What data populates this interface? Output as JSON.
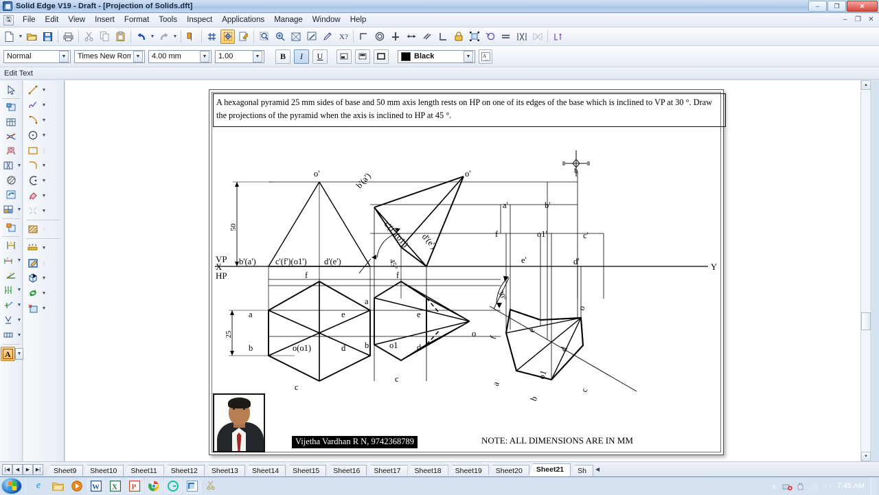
{
  "window": {
    "title": "Solid Edge V19 - Draft - [Projection of Solids.dft]",
    "app_icon": "solid-edge-icon",
    "minimize": "–",
    "maximize": "❐",
    "close": "✕",
    "mdi_minimize": "–",
    "mdi_restore": "❐",
    "mdi_close": "✕"
  },
  "menu": {
    "items": [
      "File",
      "Edit",
      "View",
      "Insert",
      "Format",
      "Tools",
      "Inspect",
      "Applications",
      "Manage",
      "Window",
      "Help"
    ]
  },
  "toolbar_main": {
    "items": [
      {
        "name": "new-document-icon",
        "glyph": "🗋"
      },
      {
        "name": "new-document-dropdown-icon",
        "glyph": "▾"
      },
      {
        "name": "open-icon",
        "glyph": "📂"
      },
      {
        "name": "save-icon",
        "glyph": "💾"
      },
      {
        "name": "print-icon",
        "glyph": "🖶"
      },
      {
        "name": "cut-icon",
        "glyph": "✂"
      },
      {
        "name": "copy-icon",
        "glyph": "⧉"
      },
      {
        "name": "paste-icon",
        "glyph": "📋"
      },
      {
        "name": "undo-icon",
        "glyph": "↰"
      },
      {
        "name": "undo-dropdown-icon",
        "glyph": "▾"
      },
      {
        "name": "redo-icon",
        "glyph": "↱"
      },
      {
        "name": "redo-dropdown-icon",
        "glyph": "▾"
      },
      {
        "name": "page-setup-icon",
        "glyph": "🏳"
      },
      {
        "name": "grid-icon",
        "glyph": "#"
      },
      {
        "name": "select-tool-icon",
        "glyph": "✛"
      },
      {
        "name": "edit-definition-icon",
        "glyph": "🗒"
      },
      {
        "name": "zoom-area-icon",
        "glyph": "🔍"
      },
      {
        "name": "zoom-in-icon",
        "glyph": "🔎"
      },
      {
        "name": "fit-icon",
        "glyph": "⛶"
      },
      {
        "name": "pan-icon",
        "glyph": "✋"
      },
      {
        "name": "sketch-view-icon",
        "glyph": "◈"
      },
      {
        "name": "help-pointer-icon",
        "glyph": "?"
      }
    ],
    "relation_items": [
      {
        "name": "connect-relation-icon",
        "glyph": "⌐"
      },
      {
        "name": "concentric-relation-icon",
        "glyph": "◎"
      },
      {
        "name": "horizontal-vertical-relation-icon",
        "glyph": "✛"
      },
      {
        "name": "equal-length-relation-icon",
        "glyph": "↔"
      },
      {
        "name": "parallel-relation-icon",
        "glyph": "⫽"
      },
      {
        "name": "perpendicular-relation-icon",
        "glyph": "∟"
      },
      {
        "name": "lock-relation-icon",
        "glyph": "🔒"
      },
      {
        "name": "rigid-set-relation-icon",
        "glyph": "▣"
      },
      {
        "name": "tangent-relation-icon",
        "glyph": "◯"
      },
      {
        "name": "equal-relation-icon",
        "glyph": "="
      },
      {
        "name": "symmetric-relation-icon",
        "glyph": "⧛"
      },
      {
        "name": "symmetry-axis-icon",
        "glyph": "⧜"
      },
      {
        "name": "relationship-handles-icon",
        "glyph": "⊥"
      }
    ]
  },
  "format_toolbar": {
    "style": {
      "value": "Normal",
      "placeholder": "Normal"
    },
    "font": {
      "value": "Times New Roman",
      "placeholder": "Times New Roman"
    },
    "size": {
      "value": "4.00 mm",
      "placeholder": "4.00 mm"
    },
    "scale": {
      "value": "1.00",
      "placeholder": "1.00"
    },
    "bold_label": "B",
    "italic_label": "I",
    "underline_label": "U",
    "align_left_icon": "align-left-icon",
    "align_center_icon": "align-center-icon",
    "align_box_icon": "border-box-icon",
    "color": {
      "value": "Black",
      "hex": "#000000"
    },
    "font_dialog_label": "A"
  },
  "prompt_bar": {
    "text": "Edit Text"
  },
  "left_toolbar_a": {
    "items": [
      {
        "name": "select-tool-icon",
        "glyph": "➚"
      },
      {
        "name": "view-sketch-icon",
        "glyph": "▤"
      },
      {
        "name": "parts-list-icon",
        "glyph": "▤"
      },
      {
        "name": "cutting-plane-icon",
        "glyph": "✂"
      },
      {
        "name": "detail-view-icon",
        "glyph": "◍"
      },
      {
        "name": "broken-view-icon",
        "glyph": "▥"
      },
      {
        "name": "hatch-area-icon",
        "glyph": "◍"
      },
      {
        "name": "update-views-icon",
        "glyph": "⟳"
      },
      {
        "name": "drawing-view-wizard-icon",
        "glyph": "▦"
      },
      {
        "name": "principal-view-icon",
        "glyph": "▣"
      },
      {
        "name": "smart-dimension-icon",
        "glyph": "↦"
      },
      {
        "name": "distance-between-icon",
        "glyph": "⇹"
      },
      {
        "name": "angle-between-icon",
        "glyph": "∡"
      },
      {
        "name": "coordinate-dimension-icon",
        "glyph": "⫼"
      },
      {
        "name": "callout-icon",
        "glyph": "✛"
      },
      {
        "name": "feature-control-frame-icon",
        "glyph": "⊽"
      },
      {
        "name": "datum-frame-icon",
        "glyph": "▩"
      },
      {
        "name": "text-tool-icon",
        "glyph": "A"
      }
    ]
  },
  "left_toolbar_b": {
    "items": [
      {
        "name": "line-tool-icon",
        "glyph": "╱"
      },
      {
        "name": "curve-tool-icon",
        "glyph": "∿"
      },
      {
        "name": "arc-tool-icon",
        "glyph": "◜"
      },
      {
        "name": "circle-tool-icon",
        "glyph": "◯"
      },
      {
        "name": "rectangle-tool-icon",
        "glyph": "▭"
      },
      {
        "name": "fillet-tool-icon",
        "glyph": "⌐"
      },
      {
        "name": "chamfer-tool-icon",
        "glyph": "◖"
      },
      {
        "name": "fill-tool-icon",
        "glyph": "◧"
      },
      {
        "name": "trim-tool-icon",
        "glyph": "✂"
      },
      {
        "name": "hatch-fill-icon",
        "glyph": "▨"
      },
      {
        "name": "balloon-icon",
        "glyph": "⁙"
      },
      {
        "name": "edge-paint-icon",
        "glyph": "🖌"
      },
      {
        "name": "part-view-icon",
        "glyph": "⬚"
      },
      {
        "name": "rotate-icon",
        "glyph": "⟳"
      },
      {
        "name": "new-layer-icon",
        "glyph": "❏"
      }
    ]
  },
  "drawing": {
    "problem_statement": "A hexagonal pyramid 25 mm sides of base and 50 mm axis length rests on HP on one of its edges of the base which is inclined to VP at 30 °. Draw the projections of the pyramid when the axis is inclined to HP at 45 °.",
    "axis_left_label": "X",
    "axis_right_label": "Y",
    "vp_label": "VP",
    "hp_label": "HP",
    "dimension_axis": "50",
    "dimension_base": "25",
    "angle_first": "45°",
    "angle_second": "30°",
    "note": "NOTE: ALL DIMENSIONS ARE IN MM",
    "nameplate": "Vijetha Vardhan R N, 9742368789",
    "view1_labels": {
      "apex": "o'",
      "fv_left": "b'(a')",
      "fv_mid": "c'(f')(o1')",
      "fv_right": "d'(e')",
      "tv_f": "f",
      "tv_a": "a",
      "tv_b": "b",
      "tv_e": "e",
      "tv_d": "d",
      "tv_c": "c",
      "tv_center": "o(o1)"
    },
    "view2_labels": {
      "apex": "o'",
      "fv_left": "b'(a')",
      "fv_mid": "c'(f')(o1')",
      "fv_right": "d'(e')",
      "tv_f": "f",
      "tv_a": "a",
      "tv_b": "b",
      "tv_e": "e",
      "tv_d": "d",
      "tv_c": "c",
      "tv_o": "o",
      "tv_o1": "o1"
    },
    "view3_labels": {
      "apex": "o'",
      "a_prime": "a'",
      "b_prime": "b'",
      "c_prime": "c'",
      "d_prime": "d'",
      "e_prime": "e'",
      "f_prime": "f",
      "o1_prime": "o1'",
      "tv_a": "a",
      "tv_b": "b",
      "tv_c": "c",
      "tv_d": "d",
      "tv_e": "e",
      "tv_f": "f",
      "tv_o": "o",
      "tv_o1": "o1"
    },
    "cursor_label": "b"
  },
  "sheet_tabs": {
    "nav": [
      "|◀",
      "◀",
      "▶",
      "▶|"
    ],
    "tabs": [
      "Sheet9",
      "Sheet10",
      "Sheet11",
      "Sheet12",
      "Sheet13",
      "Sheet14",
      "Sheet15",
      "Sheet16",
      "Sheet17",
      "Sheet18",
      "Sheet19",
      "Sheet20",
      "Sheet21",
      "Sh"
    ],
    "selected": "Sheet21",
    "overflow_indicator": "◀"
  },
  "taskbar": {
    "start_label": "start-orb",
    "items": [
      {
        "name": "internet-explorer-icon",
        "glyph": "e",
        "color": "#38a0e8"
      },
      {
        "name": "file-explorer-icon",
        "glyph": "🗀",
        "color": "#e8b84a"
      },
      {
        "name": "media-player-icon",
        "glyph": "▶",
        "color": "#e98a18"
      },
      {
        "name": "word-icon",
        "glyph": "W",
        "color": "#2b5797"
      },
      {
        "name": "excel-icon",
        "glyph": "X",
        "color": "#217346"
      },
      {
        "name": "powerpoint-icon",
        "glyph": "P",
        "color": "#d24726"
      },
      {
        "name": "chrome-icon",
        "glyph": "◉",
        "color": "#4caf50"
      },
      {
        "name": "grammarly-icon",
        "glyph": "G",
        "color": "#15c39a"
      },
      {
        "name": "solid-edge-icon",
        "glyph": "◩",
        "color": "#3d7ec0"
      },
      {
        "name": "snipping-tool-icon",
        "glyph": "✄",
        "color": "#cbd9e8"
      }
    ],
    "tray": [
      {
        "name": "show-hidden-icons-icon",
        "glyph": "▲"
      },
      {
        "name": "network-error-icon",
        "glyph": "🖧"
      },
      {
        "name": "power-plug-icon",
        "glyph": "🔌"
      },
      {
        "name": "signal-bars-icon",
        "glyph": "▂▄▆"
      },
      {
        "name": "volume-icon",
        "glyph": "🔊"
      }
    ],
    "clock": "7:45 AM"
  }
}
